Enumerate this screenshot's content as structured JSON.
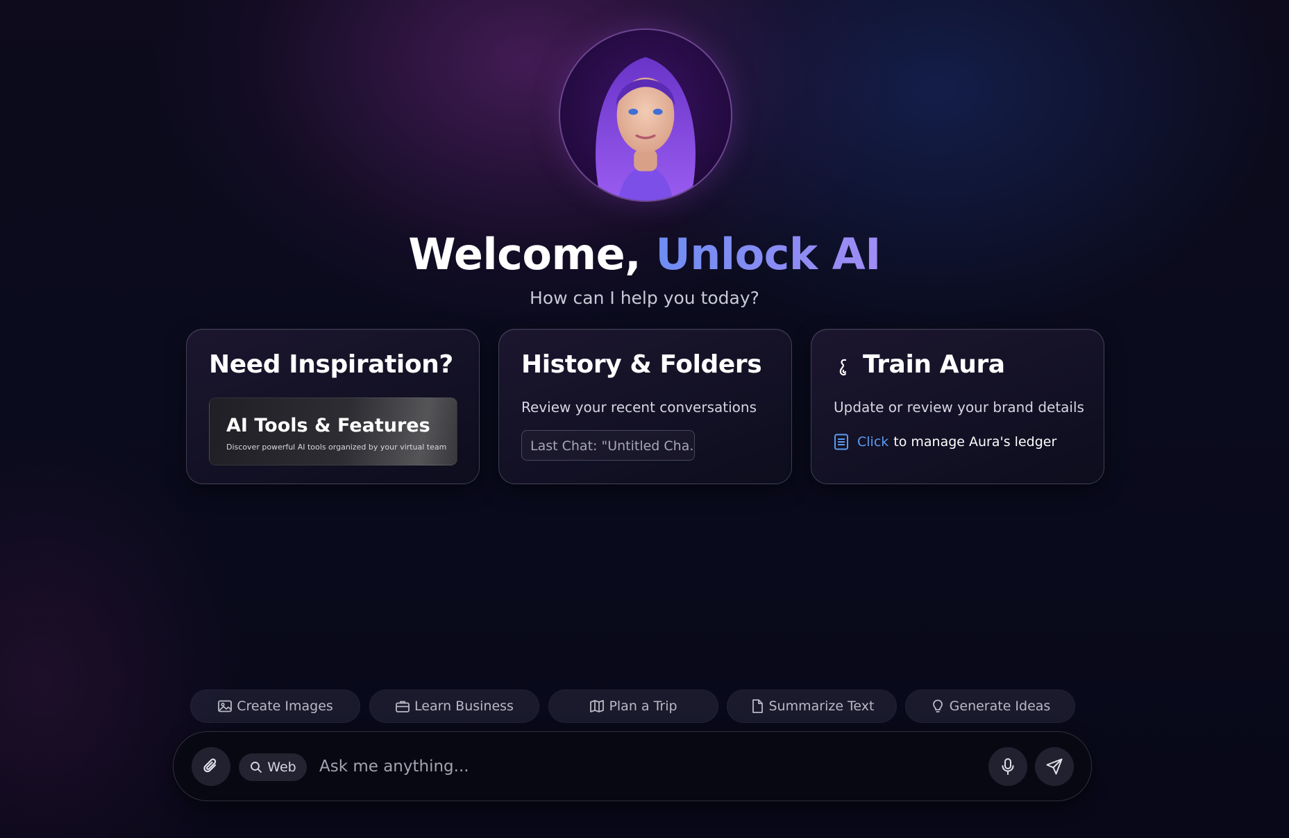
{
  "header": {
    "welcome": "Welcome,",
    "brand": "Unlock AI",
    "subtitle": "How can I help you today?"
  },
  "cards": {
    "inspiration": {
      "title": "Need Inspiration?",
      "feature_title": "AI Tools & Features",
      "feature_subtitle": "Discover powerful AI tools organized by your virtual team"
    },
    "history": {
      "title": "History & Folders",
      "description": "Review your recent conversations",
      "last_chat": "Last Chat: \"Untitled Cha..."
    },
    "train": {
      "title": "Train Aura",
      "icon": "seahorse-icon",
      "description": "Update or review your brand details",
      "link_label": "Click",
      "link_rest": "to manage Aura's ledger"
    }
  },
  "quick_actions": [
    {
      "label": "Create Images",
      "icon": "image-icon"
    },
    {
      "label": "Learn Business",
      "icon": "briefcase-icon"
    },
    {
      "label": "Plan a Trip",
      "icon": "map-icon"
    },
    {
      "label": "Summarize Text",
      "icon": "document-icon"
    },
    {
      "label": "Generate Ideas",
      "icon": "lightbulb-icon"
    }
  ],
  "chat": {
    "web_label": "Web",
    "placeholder": "Ask me anything..."
  },
  "colors": {
    "accent_blue": "#6e8df2",
    "accent_purple": "#a18cf5",
    "link_blue": "#5b9cf0"
  }
}
